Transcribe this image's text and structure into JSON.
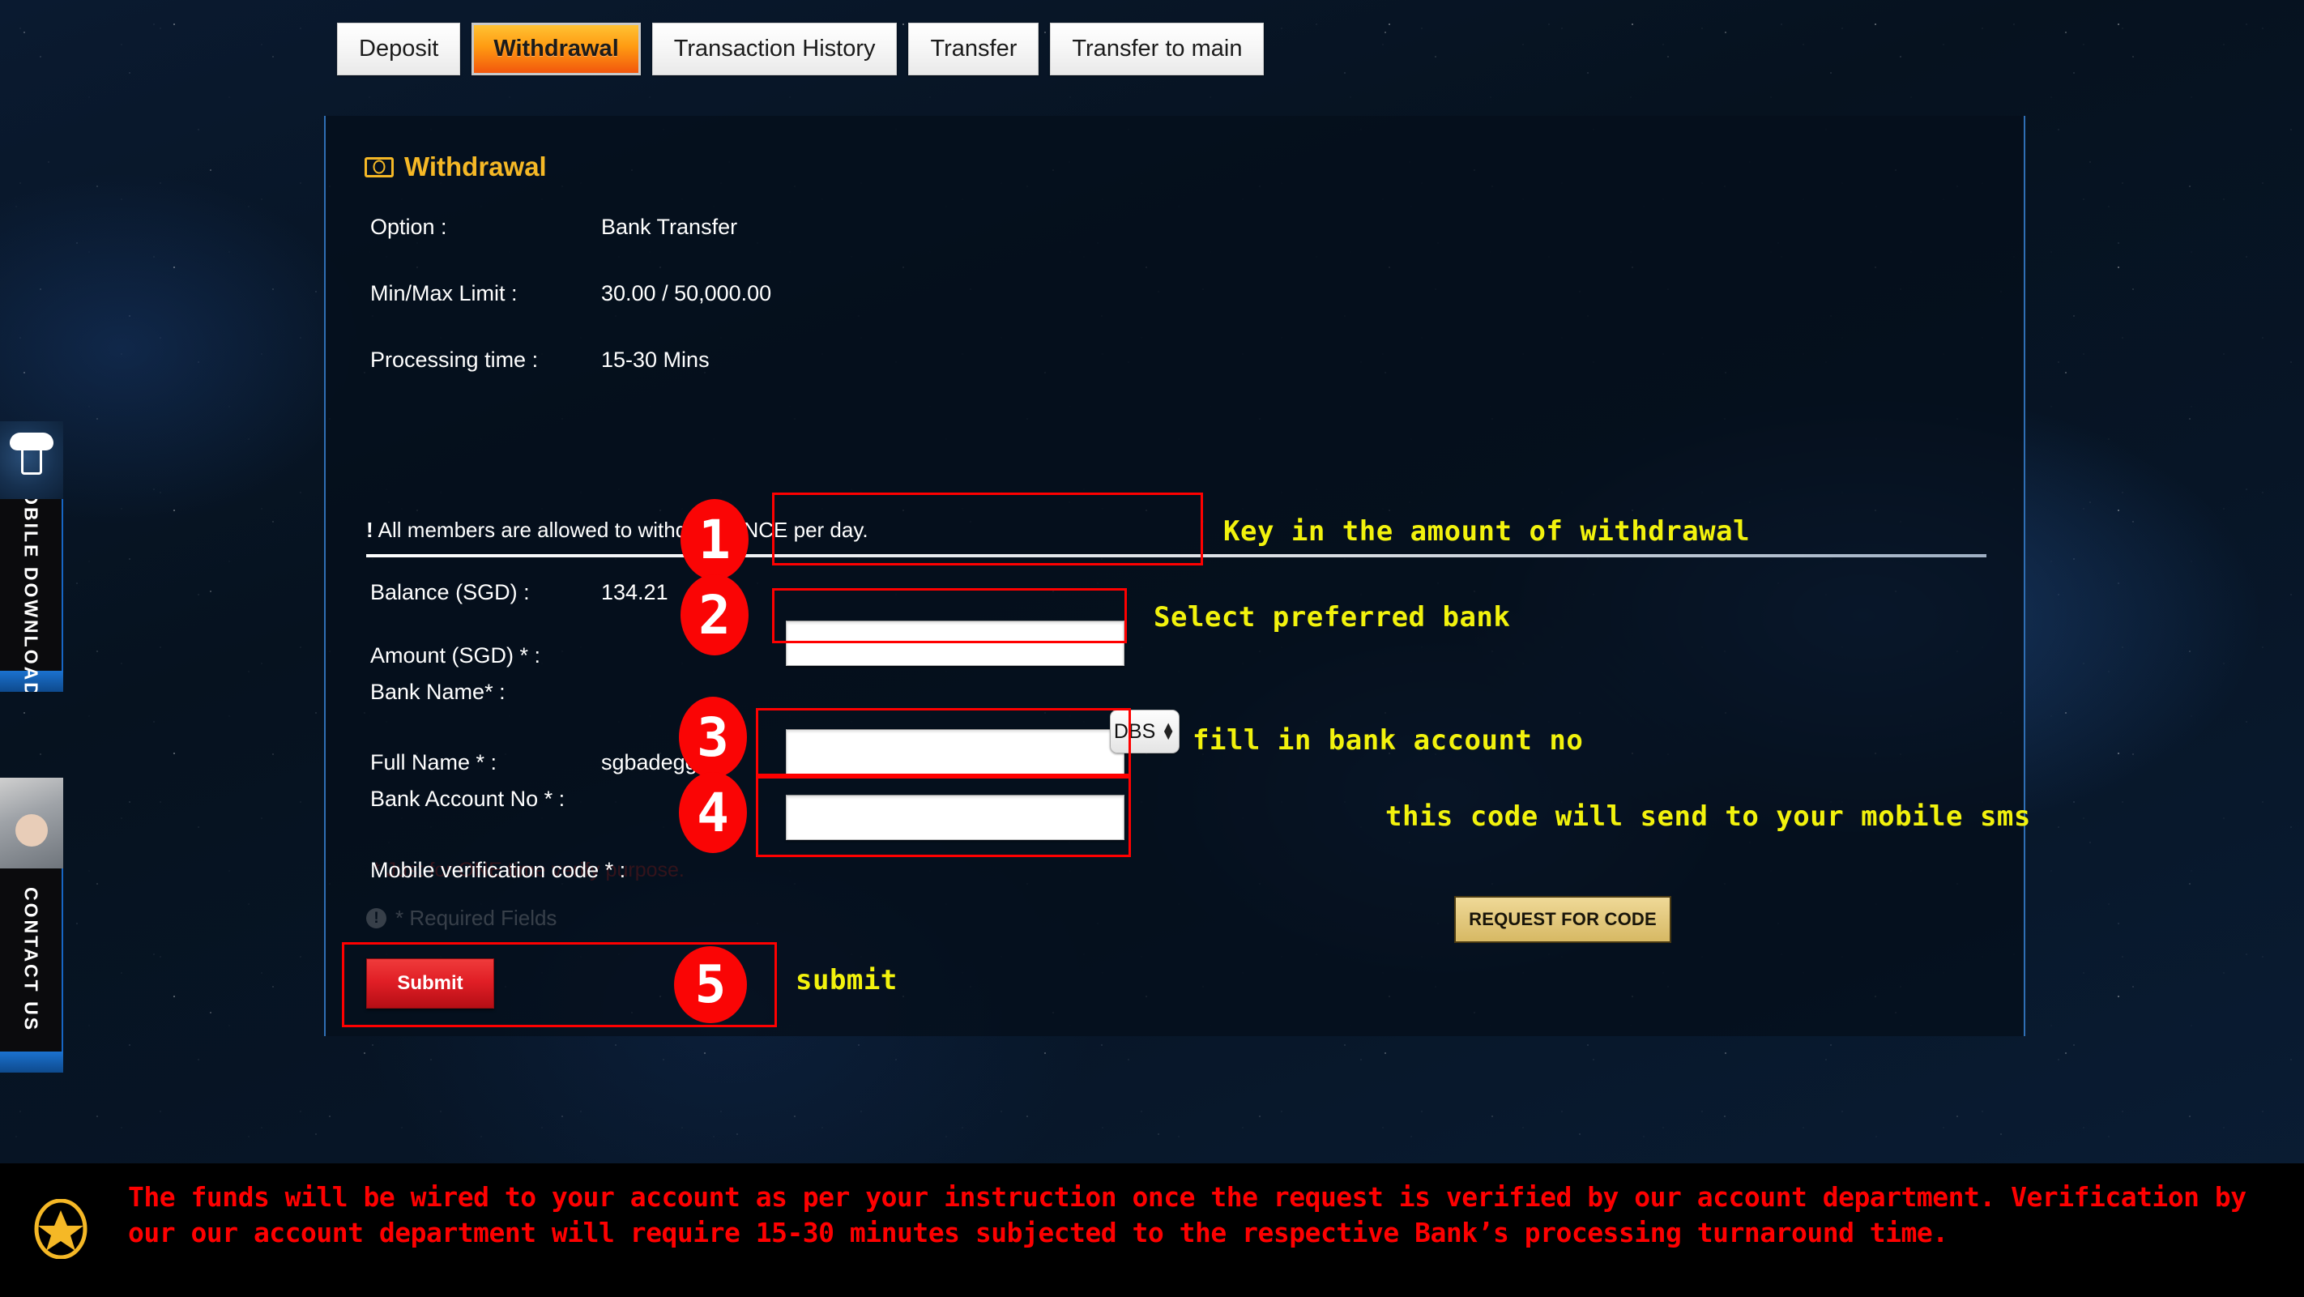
{
  "tabs": [
    {
      "label": "Deposit",
      "active": false
    },
    {
      "label": "Withdrawal",
      "active": true
    },
    {
      "label": "Transaction History",
      "active": false
    },
    {
      "label": "Transfer",
      "active": false
    },
    {
      "label": "Transfer to main",
      "active": false
    }
  ],
  "panel": {
    "title": "Withdrawal",
    "rows": [
      {
        "label": "Option :",
        "value": "Bank Transfer"
      },
      {
        "label": "Min/Max Limit :",
        "value": "30.00 / 50,000.00"
      },
      {
        "label": "Processing time :",
        "value": "15-30 Mins"
      }
    ],
    "warning": "All members are allowed to withdraw ONCE per day.",
    "warning_bang": "!",
    "balance_label": "Balance (SGD) :",
    "balance_value": "134.21",
    "amount_label": "Amount (SGD) * :",
    "amount_value": "",
    "bank_name_label": "Bank Name* :",
    "bank_selected": "DBS",
    "full_name_label": "Full Name * :",
    "full_name_value": "sgbadegg",
    "bank_account_label": "Bank Account No * :",
    "bank_account_value": "",
    "mobile_code_label": "Mobile verification code * :",
    "mobile_code_value": "",
    "request_code_label": "REQUEST FOR CODE",
    "one_time_note": "* Just for ONE time verify purpose.",
    "required_fields_note": "* Required Fields",
    "required_icon_glyph": "!",
    "submit_label": "Submit"
  },
  "annotations": [
    {
      "num": "1",
      "text": "Key in the amount of withdrawal"
    },
    {
      "num": "2",
      "text": "Select preferred bank"
    },
    {
      "num": "3",
      "text": "fill in bank account no"
    },
    {
      "num": "4",
      "text": "this code will send to your mobile sms"
    },
    {
      "num": "5",
      "text": "submit"
    }
  ],
  "banner": {
    "text": "The funds will be wired to your account as per your instruction once the request is verified by our account department. Verification by our our account department will require 15-30 minutes subjected to the respective Bank’s processing turnaround time."
  },
  "side_widgets": [
    {
      "label": "MOBILE DOWNLOAD"
    },
    {
      "label": "CONTACT US"
    }
  ],
  "colors": {
    "accent_gold": "#f5b826",
    "annotation_yellow": "#f2f20d",
    "annotation_red": "#ff0000",
    "banner_red": "#fe0000",
    "active_tab_orange": "#ff9b12",
    "submit_red": "#e11f26"
  }
}
